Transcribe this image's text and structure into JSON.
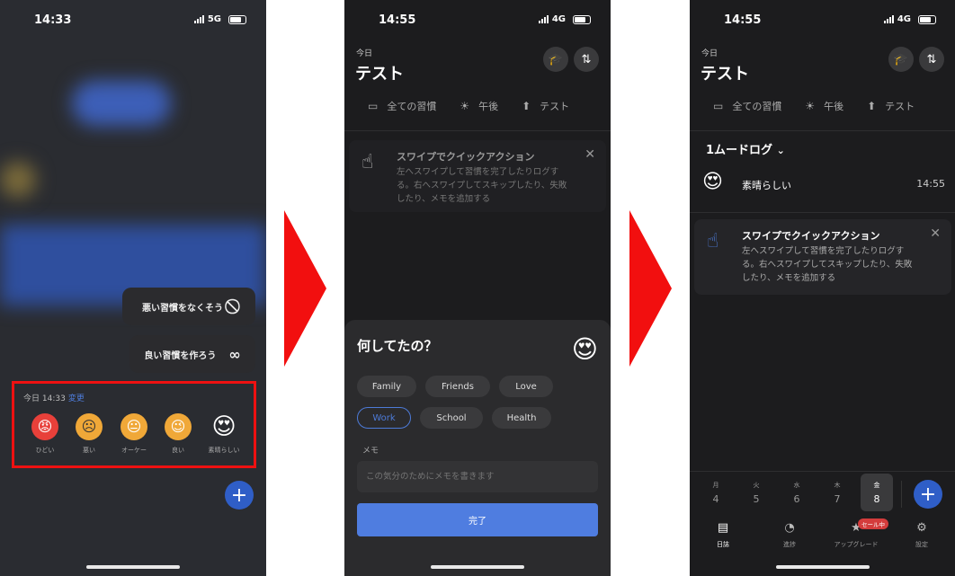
{
  "phone1": {
    "status": {
      "time": "14:33",
      "network": "5G"
    },
    "quick_bad": "悪い習慣をなくそう",
    "quick_good": "良い習慣を作ろう",
    "mood": {
      "date": "今日 14:33",
      "change": "変更",
      "options": [
        {
          "label": "ひどい",
          "emoji": "😡",
          "color": "#e8403a"
        },
        {
          "label": "悪い",
          "emoji": "☹",
          "color": "#f0a838"
        },
        {
          "label": "オーケー",
          "emoji": "😐",
          "color": "#f0a838"
        },
        {
          "label": "良い",
          "emoji": "😉",
          "color": "#f0a838"
        },
        {
          "label": "素晴らしい",
          "emoji": "😍",
          "color": "#f0a838"
        }
      ]
    },
    "fab": "+"
  },
  "phone2": {
    "status": {
      "time": "14:55",
      "network": "4G"
    },
    "today": "今日",
    "title": "テスト",
    "tabs": [
      "全ての習慣",
      "午後",
      "テスト"
    ],
    "swipe": {
      "title": "スワイプでクイックアクション",
      "body": "左へスワイプして習慣を完了したりログする。右へスワイプしてスキップしたり、失敗したり、メモを追加する"
    },
    "sheet": {
      "question": "何してたの？",
      "emoji": "😍",
      "chips": [
        "Family",
        "Friends",
        "Love",
        "Work",
        "School",
        "Health"
      ],
      "selected": "Work",
      "memo_label": "メモ",
      "memo_placeholder": "この気分のためにメモを書きます",
      "done": "完了"
    }
  },
  "phone3": {
    "status": {
      "time": "14:55",
      "network": "4G"
    },
    "today": "今日",
    "title": "テスト",
    "tabs": [
      "全ての習慣",
      "午後",
      "テスト"
    ],
    "moodlog": "1ムードログ",
    "log": {
      "emoji": "😍",
      "name": "素晴らしい",
      "time": "14:55"
    },
    "swipe": {
      "title": "スワイプでクイックアクション",
      "body": "左へスワイプして習慣を完了したりログする。右へスワイプしてスキップしたり、失敗したり、メモを追加する"
    },
    "week": [
      {
        "w": "月",
        "d": "4"
      },
      {
        "w": "火",
        "d": "5"
      },
      {
        "w": "水",
        "d": "6"
      },
      {
        "w": "木",
        "d": "7"
      },
      {
        "w": "金",
        "d": "8"
      }
    ],
    "nav": [
      "日誌",
      "進捗",
      "アップグレード",
      "設定"
    ],
    "sale": "セール中"
  },
  "colors": {
    "accent": "#4f7de0",
    "arrow": "#f20f0f",
    "highlight": "#ee1111"
  }
}
